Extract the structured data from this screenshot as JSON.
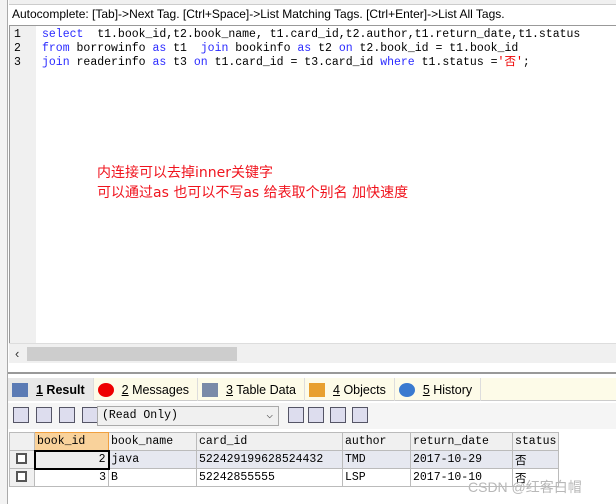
{
  "autocomplete_hint": "Autocomplete: [Tab]->Next Tag. [Ctrl+Space]->List Matching Tags. [Ctrl+Enter]->List All Tags.",
  "editor": {
    "lines": [
      {
        "n": "1",
        "parts": [
          {
            "t": "select",
            "k": true
          },
          {
            "t": "  t1.book_id,t2.book_name, t1.card_id,t2.author,t1.return_date,t1.status"
          }
        ]
      },
      {
        "n": "2",
        "parts": [
          {
            "t": "from",
            "k": true
          },
          {
            "t": " borrowinfo "
          },
          {
            "t": "as",
            "k": true
          },
          {
            "t": " t1  "
          },
          {
            "t": "join",
            "k": true
          },
          {
            "t": " bookinfo "
          },
          {
            "t": "as",
            "k": true
          },
          {
            "t": " t2 "
          },
          {
            "t": "on",
            "k": true
          },
          {
            "t": " t2.book_id = t1.book_id"
          }
        ]
      },
      {
        "n": "3",
        "parts": [
          {
            "t": "join",
            "k": true
          },
          {
            "t": " readerinfo "
          },
          {
            "t": "as",
            "k": true
          },
          {
            "t": " t3 "
          },
          {
            "t": "on",
            "k": true
          },
          {
            "t": " t1.card_id = t3.card_id "
          },
          {
            "t": "where",
            "k": true
          },
          {
            "t": " t1.status ="
          },
          {
            "t": "'否'",
            "s": true
          },
          {
            "t": ";"
          }
        ]
      }
    ]
  },
  "notes": [
    "内连接可以去掉inner关键字",
    "可以通过as 也可以不写as 给表取个别名 加快速度"
  ],
  "tabs": [
    {
      "num": "1",
      "label": " Result",
      "icon": "result-grid-icon",
      "active": true
    },
    {
      "num": "2",
      "label": " Messages",
      "icon": "error-icon"
    },
    {
      "num": "3",
      "label": " Table Data",
      "icon": "table-data-icon"
    },
    {
      "num": "4",
      "label": " Objects",
      "icon": "objects-icon"
    },
    {
      "num": "5",
      "label": " History",
      "icon": "history-icon"
    }
  ],
  "result_mode": "(Read Only)",
  "table": {
    "columns": [
      "book_id",
      "book_name",
      "card_id",
      "author",
      "return_date",
      "status"
    ],
    "rows": [
      [
        "2",
        "java",
        "522429199628524432",
        "TMD",
        "2017-10-29",
        "否"
      ],
      [
        "3",
        "B",
        "52242855555",
        "LSP",
        "2017-10-10",
        "否"
      ]
    ]
  },
  "watermark": "CSDN @红客白帽"
}
